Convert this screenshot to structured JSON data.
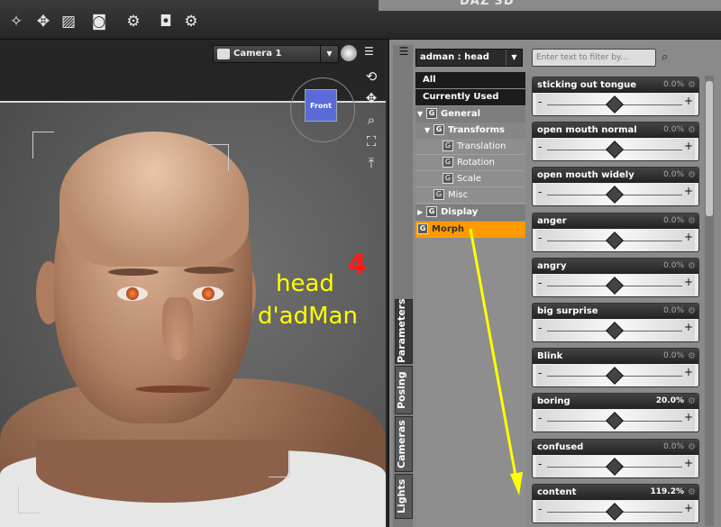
{
  "toolbar": {
    "logo_text": "DAZ 3D",
    "tools": [
      "node-select-icon",
      "universal-tool-icon",
      "geometry-editor-icon",
      "photo-icon",
      "render-settings-icon",
      "render-icon",
      "camera-gear-icon"
    ]
  },
  "viewport": {
    "camera_label": "Camera 1",
    "cube_label": "Front",
    "tools": [
      "orbit-icon",
      "pan-icon",
      "zoom-icon",
      "frame-icon",
      "reset-icon"
    ],
    "overlay": {
      "line1": "head",
      "number": "4",
      "line2": "d'adMan"
    }
  },
  "panel": {
    "node_select": "adman : head",
    "filter_placeholder": "Enter text to filter by...",
    "vtabs": [
      "Parameters",
      "Posing",
      "Cameras",
      "Lights"
    ],
    "tree": {
      "all": "All",
      "currently_used": "Currently Used",
      "general": "General",
      "transforms": "Transforms",
      "translation": "Translation",
      "rotation": "Rotation",
      "scale": "Scale",
      "misc": "Misc",
      "display": "Display",
      "morph": "Morph"
    },
    "params": [
      {
        "name": "sticking out tongue",
        "value": "0.0%",
        "level": 0.5
      },
      {
        "name": "open mouth normal",
        "value": "0.0%",
        "level": 0.5
      },
      {
        "name": "open mouth  widely",
        "value": "0.0%",
        "level": 0.5
      },
      {
        "name": "anger",
        "value": "0.0%",
        "level": 0.5
      },
      {
        "name": "angry",
        "value": "0.0%",
        "level": 0.5
      },
      {
        "name": "big surprise",
        "value": "0.0%",
        "level": 0.5
      },
      {
        "name": "Blink",
        "value": "0.0%",
        "level": 0.5
      },
      {
        "name": "boring",
        "value": "20.0%",
        "level": 0.5
      },
      {
        "name": "confused",
        "value": "0.0%",
        "level": 0.5
      },
      {
        "name": "content",
        "value": "119.2%",
        "level": 0.5
      }
    ]
  },
  "colors": {
    "selected": "#ff9a00",
    "annotation": "#ffff00",
    "number": "#ff1a1a"
  }
}
